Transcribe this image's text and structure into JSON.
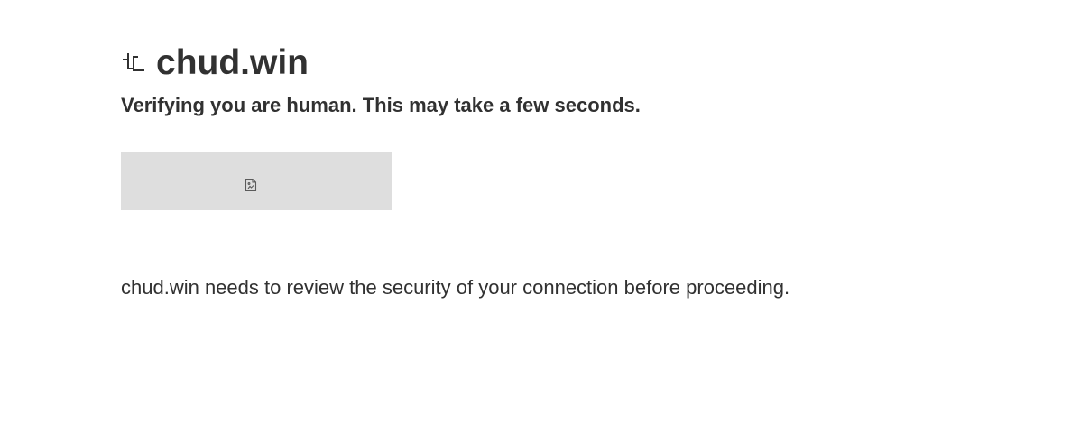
{
  "site": {
    "name": "chud.win",
    "icon": "broken-favicon-icon"
  },
  "challenge": {
    "subtitle": "Verifying you are human. This may take a few seconds.",
    "widget_icon": "broken-frame-icon",
    "widget_background": "#dedede"
  },
  "description": "chud.win needs to review the security of your connection before proceeding."
}
